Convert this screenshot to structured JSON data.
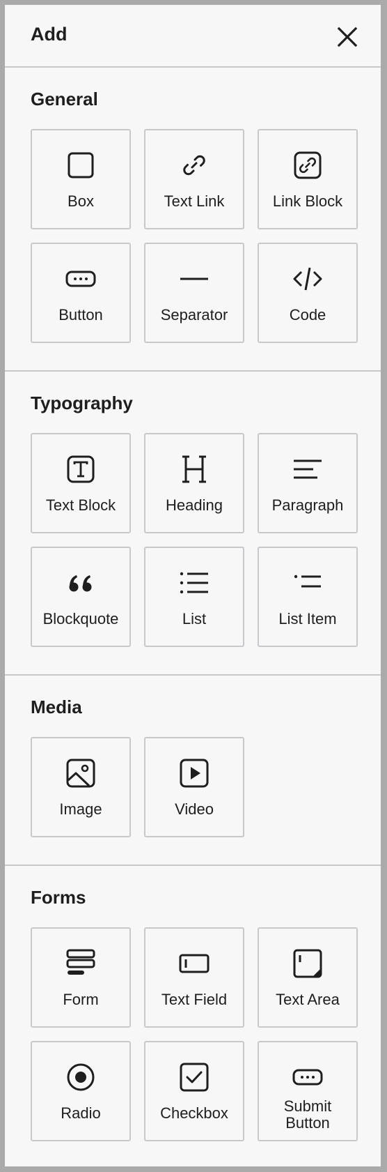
{
  "header": {
    "title": "Add",
    "close_icon": "close-icon"
  },
  "sections": [
    {
      "title": "General",
      "items": [
        {
          "label": "Box",
          "icon": "box-icon"
        },
        {
          "label": "Text Link",
          "icon": "link-icon"
        },
        {
          "label": "Link Block",
          "icon": "link-block-icon"
        },
        {
          "label": "Button",
          "icon": "button-icon"
        },
        {
          "label": "Separator",
          "icon": "separator-icon"
        },
        {
          "label": "Code",
          "icon": "code-icon"
        }
      ]
    },
    {
      "title": "Typography",
      "items": [
        {
          "label": "Text Block",
          "icon": "text-block-icon"
        },
        {
          "label": "Heading",
          "icon": "heading-icon"
        },
        {
          "label": "Paragraph",
          "icon": "paragraph-icon"
        },
        {
          "label": "Blockquote",
          "icon": "blockquote-icon"
        },
        {
          "label": "List",
          "icon": "list-icon"
        },
        {
          "label": "List Item",
          "icon": "list-item-icon"
        }
      ]
    },
    {
      "title": "Media",
      "items": [
        {
          "label": "Image",
          "icon": "image-icon"
        },
        {
          "label": "Video",
          "icon": "video-icon"
        }
      ]
    },
    {
      "title": "Forms",
      "items": [
        {
          "label": "Form",
          "icon": "form-icon"
        },
        {
          "label": "Text Field",
          "icon": "text-field-icon"
        },
        {
          "label": "Text Area",
          "icon": "text-area-icon"
        },
        {
          "label": "Radio",
          "icon": "radio-icon"
        },
        {
          "label": "Checkbox",
          "icon": "checkbox-icon"
        },
        {
          "label": "Submit Button",
          "icon": "submit-button-icon"
        }
      ]
    }
  ]
}
